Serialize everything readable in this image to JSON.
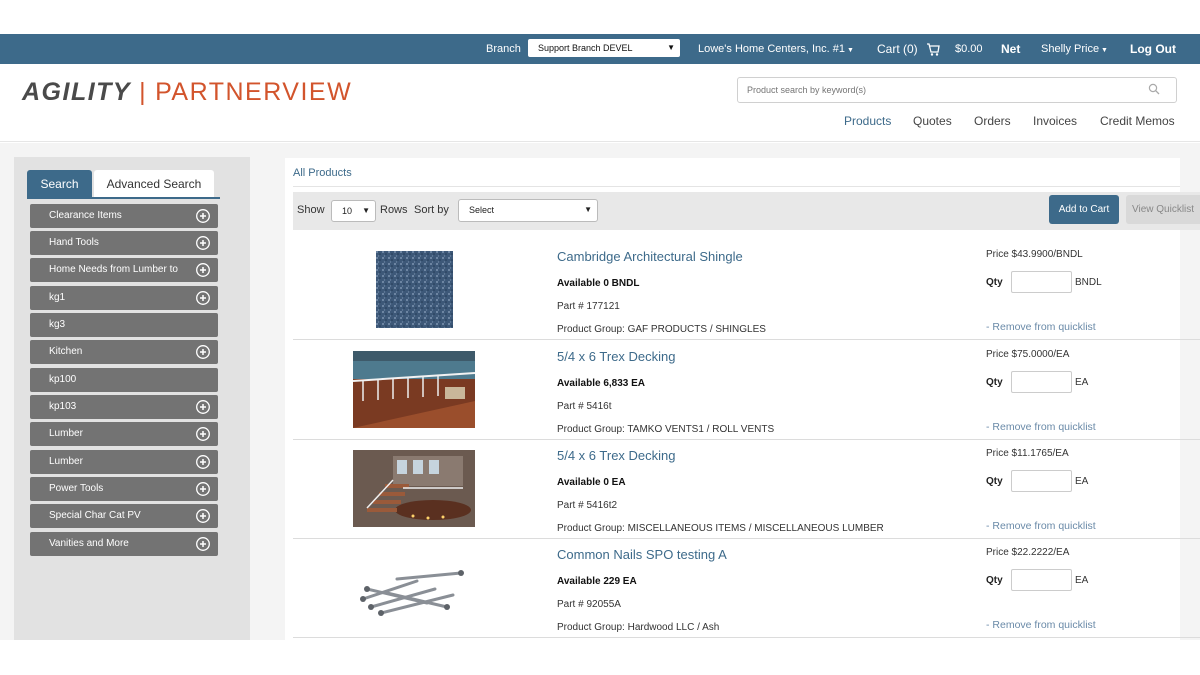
{
  "topbar": {
    "branch_label": "Branch",
    "branch_value": "Support Branch DEVEL",
    "account": "Lowe's Home Centers, Inc. #1",
    "cart": "Cart (0)",
    "cart_total": "$0.00",
    "net": "Net",
    "user": "Shelly Price",
    "logout": "Log Out"
  },
  "header": {
    "logo_left": "AGILITY",
    "logo_sep": "|",
    "logo_right": "PARTNERVIEW",
    "search_placeholder": "Product search by keyword(s)",
    "nav": [
      "Products",
      "Quotes",
      "Orders",
      "Invoices",
      "Credit Memos"
    ]
  },
  "sidebar": {
    "tabs": [
      "Search",
      "Advanced Search"
    ],
    "categories": [
      {
        "label": "Clearance Items",
        "expandable": true
      },
      {
        "label": "Hand Tools",
        "expandable": true
      },
      {
        "label": "Home Needs from Lumber to",
        "expandable": true
      },
      {
        "label": "kg1",
        "expandable": true
      },
      {
        "label": "kg3",
        "expandable": false
      },
      {
        "label": "Kitchen",
        "expandable": true
      },
      {
        "label": "kp100",
        "expandable": false
      },
      {
        "label": "kp103",
        "expandable": true
      },
      {
        "label": "Lumber",
        "expandable": true
      },
      {
        "label": "Lumber",
        "expandable": true
      },
      {
        "label": "Power Tools",
        "expandable": true
      },
      {
        "label": "Special Char Cat PV",
        "expandable": true
      },
      {
        "label": "Vanities and More",
        "expandable": true
      }
    ]
  },
  "main": {
    "breadcrumb": "All Products",
    "show_label": "Show",
    "rows_value": "10",
    "rows_label": "Rows",
    "sort_label": "Sort by",
    "sort_value": "Select",
    "add_to_cart": "Add to Cart",
    "view_quicklist": "View Quicklist",
    "products": [
      {
        "name": "Cambridge Architectural Shingle",
        "available": "Available  0 BNDL",
        "part": "Part #  177121",
        "group": "Product Group:  GAF PRODUCTS / SHINGLES",
        "price": "Price  $43.9900/BNDL",
        "qty_label": "Qty",
        "unit": "BNDL",
        "remove": "- Remove from quicklist"
      },
      {
        "name": "5/4 x 6 Trex Decking",
        "available": "Available  6,833 EA",
        "part": "Part #  5416t",
        "group": "Product Group:  TAMKO VENTS1 / ROLL VENTS",
        "price": "Price  $75.0000/EA",
        "qty_label": "Qty",
        "unit": "EA",
        "remove": "- Remove from quicklist"
      },
      {
        "name": "5/4 x 6 Trex Decking",
        "available": "Available  0 EA",
        "part": "Part #  5416t2",
        "group": "Product Group:  MISCELLANEOUS ITEMS / MISCELLANEOUS LUMBER",
        "price": "Price  $11.1765/EA",
        "qty_label": "Qty",
        "unit": "EA",
        "remove": "- Remove from quicklist"
      },
      {
        "name": "Common Nails SPO testing A",
        "available": "Available  229 EA",
        "part": "Part #  92055A",
        "group": "Product Group:  Hardwood LLC / Ash",
        "price": "Price  $22.2222/EA",
        "qty_label": "Qty",
        "unit": "EA",
        "remove": "- Remove from quicklist"
      }
    ]
  },
  "colors": {
    "brand_blue": "#3d6a8a",
    "logo_orange": "#d2542c",
    "category_gray": "#737373"
  },
  "icons": [
    "cart-icon",
    "search-icon",
    "plus-circle-icon",
    "dropdown-caret-icon"
  ]
}
